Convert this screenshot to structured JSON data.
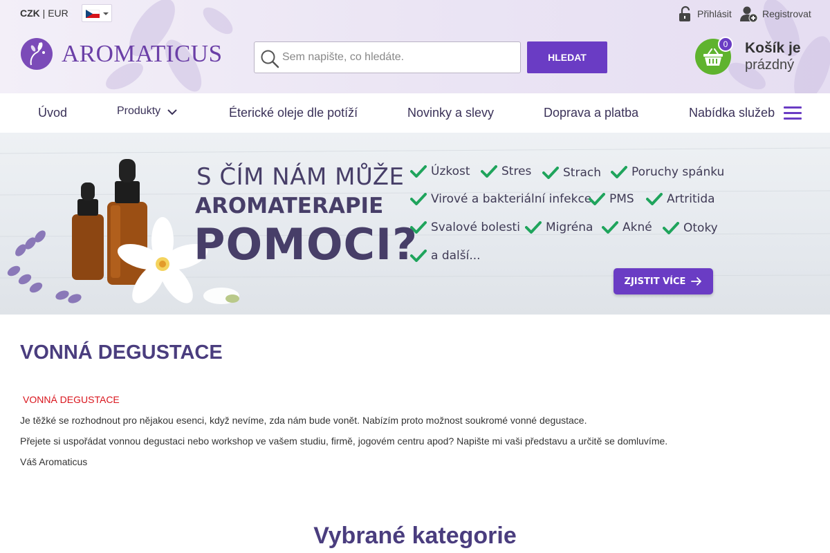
{
  "topbar": {
    "currency_active": "CZK",
    "currency_sep": " | ",
    "currency_other": "EUR",
    "language": "cs",
    "login_label": "Přihlásit",
    "register_label": "Registrovat"
  },
  "brand": {
    "name": "AROMATICUS",
    "color": "#6b3fa7"
  },
  "search": {
    "placeholder": "Sem napište, co hledáte.",
    "value": "",
    "button_label": "HLEDAT"
  },
  "cart": {
    "count": "0",
    "title": "Košík je",
    "subtitle": "prázdný",
    "color": "#5fb32e"
  },
  "nav": {
    "items": [
      {
        "label": "Úvod"
      },
      {
        "label": "Produkty"
      },
      {
        "label": "Éterické oleje dle potíží"
      },
      {
        "label": "Novinky a slevy"
      },
      {
        "label": "Doprava a platba"
      },
      {
        "label": "Nabídka služeb"
      }
    ],
    "accent": "#6a3cc4"
  },
  "banner": {
    "line1": "S ČÍM NÁM MŮŽE",
    "line2": "AROMATERAPIE",
    "line3": "POMOCI?",
    "checks": [
      "Úzkost",
      "Stres",
      "Strach",
      "Poruchy spánku",
      "Virové a bakteriální infekce",
      "PMS",
      "Artritida",
      "Svalové bolesti",
      "Migréna",
      "Akné",
      "Otoky",
      "a další..."
    ],
    "cta_label": "ZJISTIT VÍCE"
  },
  "content": {
    "title": "VONNÁ DEGUSTACE",
    "section_heading": "VONNÁ DEGUSTACE",
    "paragraphs": [
      "Je těžké se rozhodnout pro nějakou esenci, když nevíme, zda nám bude vonět. Nabízím proto možnost soukromé vonné degustace.",
      "Přejete si uspořádat vonnou degustaci nebo workshop ve vašem studiu, firmě, jogovém centru apod? Napište mi vaši představu a určitě se domluvíme.",
      "Váš Aromaticus"
    ],
    "categories_heading": "Vybrané kategorie"
  }
}
